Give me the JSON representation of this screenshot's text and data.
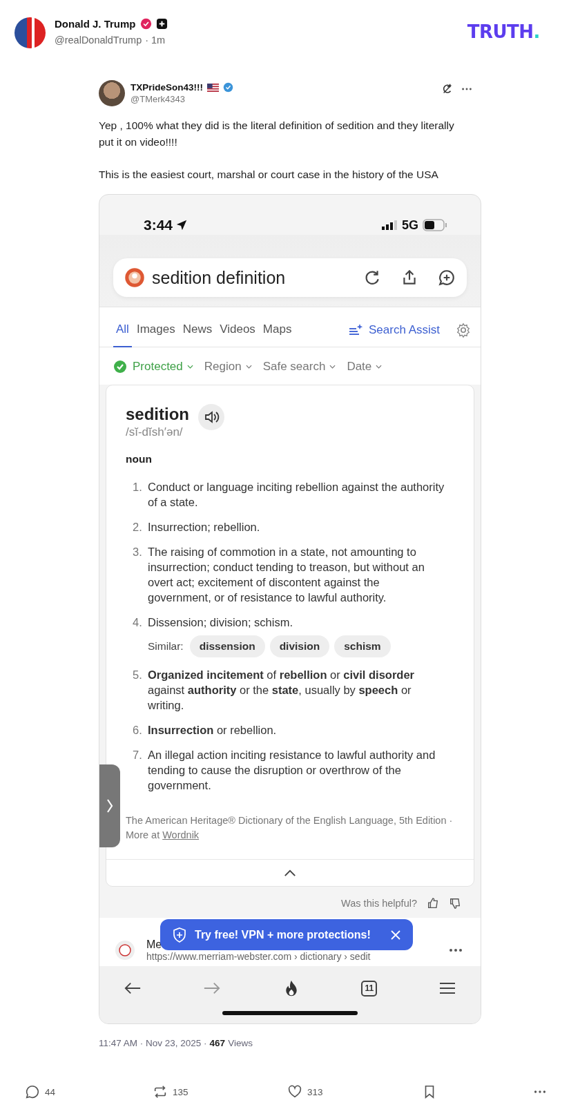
{
  "post": {
    "author": "Donald J. Trump",
    "handle": "@realDonaldTrump",
    "time": "· 1m",
    "verified": true,
    "logo": {
      "text": "TRUTH",
      "dot": "."
    }
  },
  "quote": {
    "author": "TXPrideSon43!!!",
    "handle": "@TMerk4343",
    "verified": true,
    "paragraphs": [
      "Yep , 100% what they did is the literal definition of sedition and they literally put it on video!!!!",
      "This is the easiest court, marshal or court case in the history of the USA"
    ]
  },
  "phone": {
    "clock": "3:44",
    "network": "5G",
    "query": "sedition definition",
    "tabs": [
      {
        "label": "All",
        "selected": true
      },
      {
        "label": "Images",
        "selected": false
      },
      {
        "label": "News",
        "selected": false
      },
      {
        "label": "Videos",
        "selected": false
      },
      {
        "label": "Maps",
        "selected": false
      }
    ],
    "assist": "Search Assist",
    "filters": [
      {
        "kind": "status",
        "label": "Protected"
      },
      {
        "kind": "dropdown",
        "label": "Region"
      },
      {
        "kind": "dropdown",
        "label": "Safe search"
      },
      {
        "kind": "dropdown",
        "label": "Date"
      }
    ],
    "card": {
      "word": "sedition",
      "pronunciation": "/sĭ-dĭsh′ən/",
      "pos": "noun",
      "definitions": [
        {
          "num": "1.",
          "text": "Conduct or language inciting rebellion against the authority of a state."
        },
        {
          "num": "2.",
          "text": "Insurrection; rebellion."
        },
        {
          "num": "3.",
          "text": "The raising of commotion in a state, not amounting to insurrection; conduct tending to treason, but without an overt act; excitement of discontent against the government, or of resistance to lawful authority."
        },
        {
          "num": "4.",
          "text": "Dissension; division; schism.",
          "similar_label": "Similar:",
          "similar": [
            "dissension",
            "division",
            "schism"
          ]
        },
        {
          "num": "5.",
          "text": "**Organized incitement** of **rebellion** or **civil disorder** against **authority** or the **state**, usually by **speech** or writing."
        },
        {
          "num": "6.",
          "text": "**Insurrection** or rebellion."
        },
        {
          "num": "7.",
          "text": "An illegal action inciting resistance to lawful authority and tending to cause the disruption or overthrow of the government."
        }
      ],
      "source": "The American Heritage® Dictionary of the English Language, 5th Edition ·  More at",
      "source_link": "Wordnik"
    },
    "helpful": "Was this helpful?",
    "banner": "Try free! VPN + more protections!",
    "result": {
      "title": "Me",
      "url": "https://www.merriam-webster.com › dictionary › sedit"
    },
    "tab_count": "11"
  },
  "footer": {
    "timestamp": "11:47 AM · Nov 23, 2025 ·",
    "views": "467",
    "views_label": "Views",
    "actions": [
      {
        "kind": "reply",
        "count": "44"
      },
      {
        "kind": "repost",
        "count": "135"
      },
      {
        "kind": "like",
        "count": "313"
      },
      {
        "kind": "bookmark"
      },
      {
        "kind": "more"
      }
    ]
  }
}
